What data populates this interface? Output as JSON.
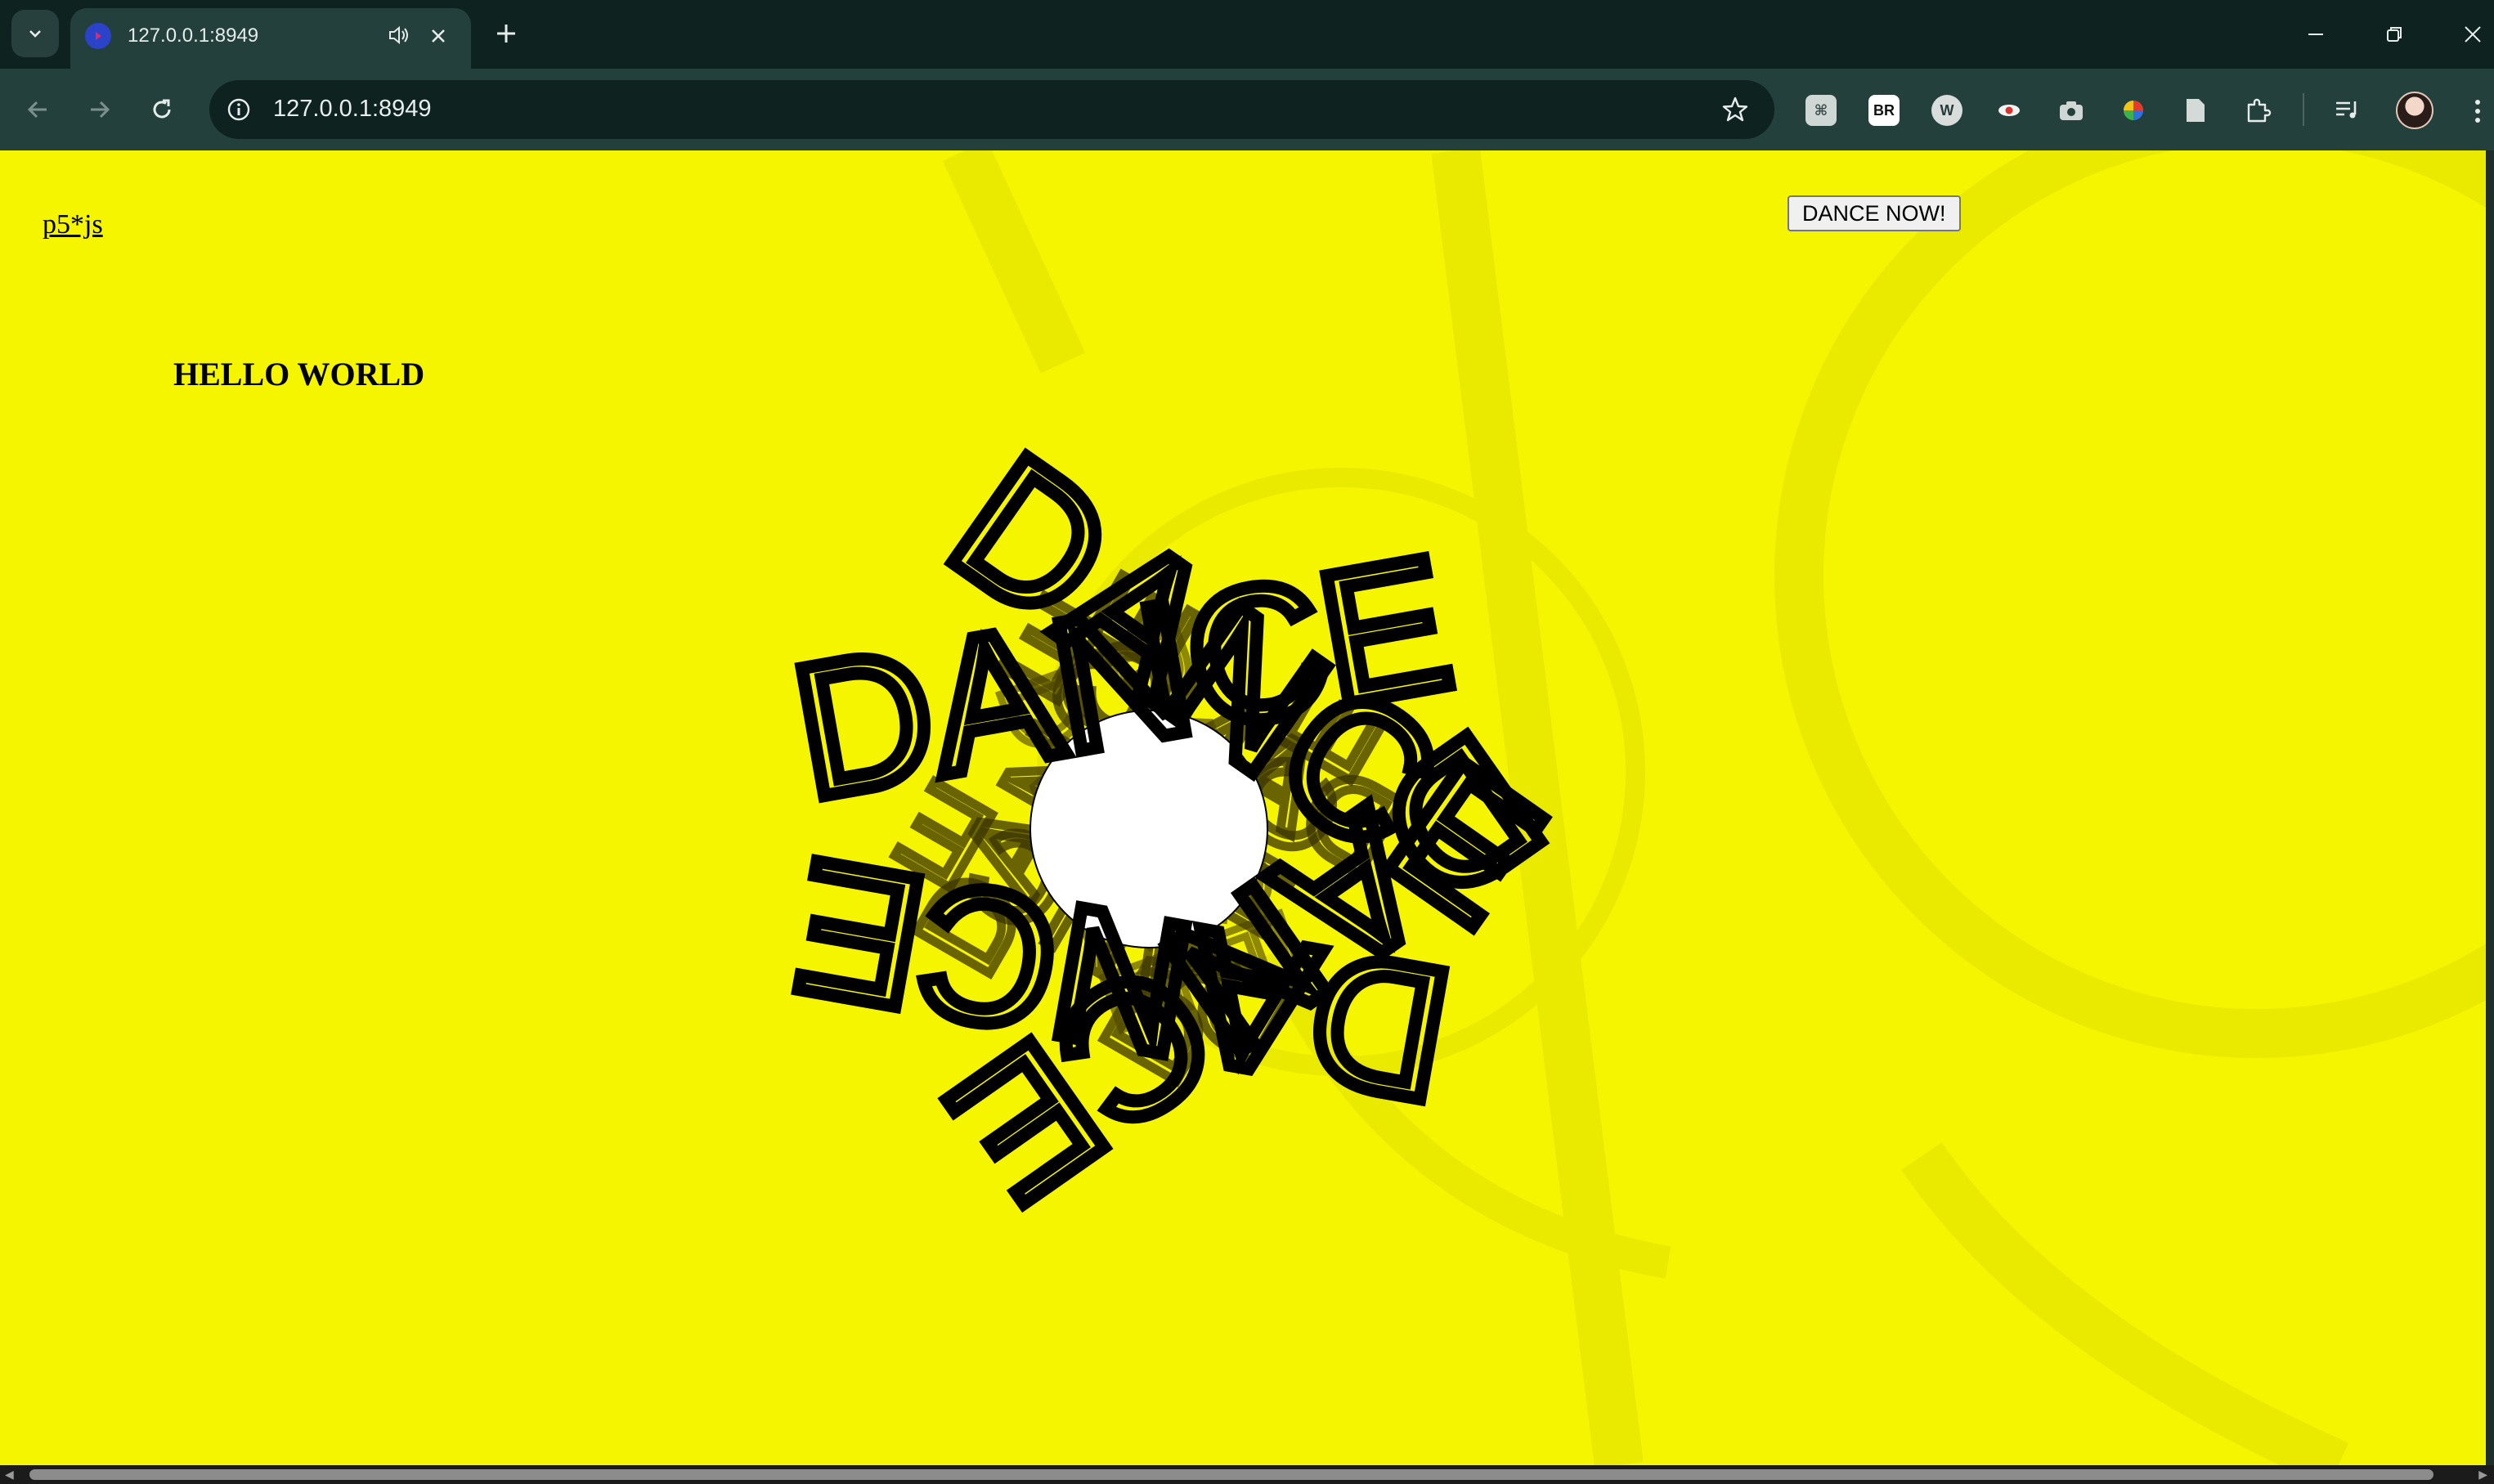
{
  "browser": {
    "tab": {
      "title": "127.0.0.1:8949",
      "favicon": "p5-play-icon",
      "audio": "speaker-icon"
    },
    "url": "127.0.0.1:8949",
    "extensions": [
      "grammarly-icon",
      "br-icon",
      "w-icon",
      "eye-icon",
      "camera-icon",
      "color-picker-icon",
      "document-icon",
      "puzzle-icon"
    ],
    "extension_labels": {
      "br": "BR"
    }
  },
  "page": {
    "link_text": "p5*js",
    "heading": "HELLO WORLD",
    "button_label": "DANCE NOW!",
    "background_color": "#f6f500",
    "sketch_word": "DANCE"
  }
}
